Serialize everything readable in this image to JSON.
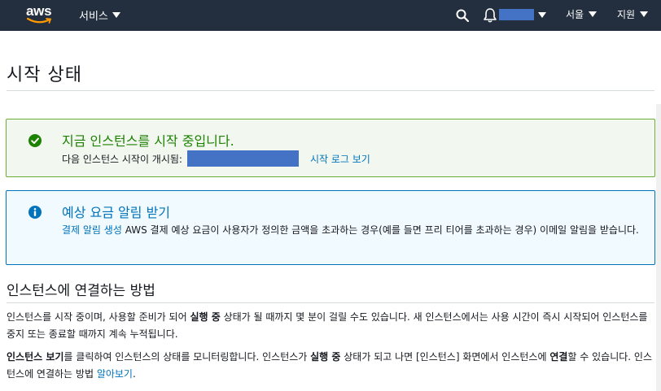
{
  "header": {
    "logo_text": "aws",
    "services_label": "서비스",
    "region_label": "서울",
    "support_label": "지원",
    "colors": {
      "bar": "#232f3e",
      "smile": "#ff9900",
      "redaction": "#4472c4"
    }
  },
  "page": {
    "title": "시작 상태"
  },
  "success_alert": {
    "heading": "지금 인스턴스를 시작 중입니다.",
    "launch_prefix": "다음 인스턴스 시작이 개시됨:",
    "view_log_link": "시작 로그 보기",
    "icon": "check-circle-icon",
    "color": "#1d8102"
  },
  "billing_alert": {
    "heading": "예상 요금 알림 받기",
    "create_link": "결제 알림 생성",
    "body_text": "AWS 결제 예상 요금이 사용자가 정의한 금액을 초과하는 경우(예를 들면 프리 티어를 초과하는 경우) 이메일 알림을 받습니다.",
    "icon": "info-circle-icon",
    "color": "#0073bb"
  },
  "connect_section": {
    "title": "인스턴스에 연결하는 방법",
    "p1": {
      "before": "인스턴스를 시작 중이며, 사용할 준비가 되어 ",
      "bold": "실행 중",
      "after": " 상태가 될 때까지 몇 분이 걸릴 수도 있습니다. 새 인스턴스에서는 사용 시간이 즉시 시작되어 인스턴스를 중지 또는 종료할 때까지 계속 누적됩니다."
    },
    "p2": {
      "bold1": "인스턴스 보기",
      "text1": "를 클릭하여 인스턴스의 상태를 모니터링합니다. 인스턴스가 ",
      "bold2": "실행 중",
      "text2": " 상태가 되고 나면 [인스턴스] 화면에서 인스턴스에 ",
      "bold3": "연결",
      "text3": "할 수 있습니다. 인스턴스에 연결하는 방법 ",
      "link": "알아보기",
      "end": "."
    }
  }
}
